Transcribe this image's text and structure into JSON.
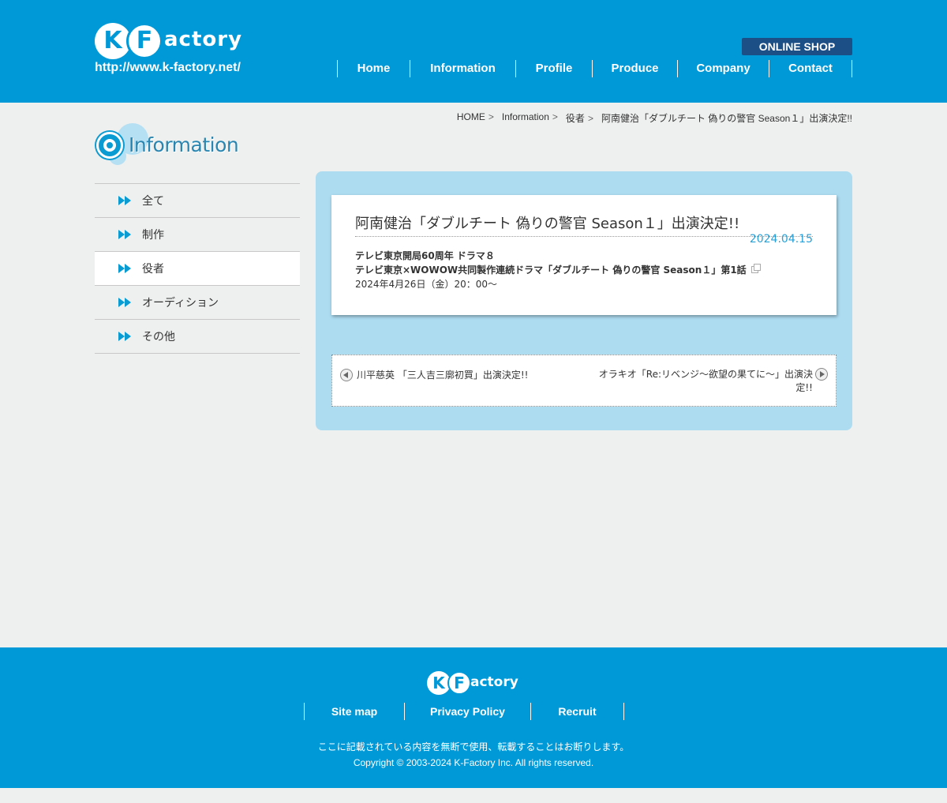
{
  "header": {
    "logo_k": "K",
    "logo_f": "F",
    "logo_rest": "actory",
    "url": "http://www.k-factory.net/",
    "shop_label": "ONLINE SHOP",
    "nav": [
      {
        "label": "Home"
      },
      {
        "label": "Information"
      },
      {
        "label": "Profile"
      },
      {
        "label": "Produce"
      },
      {
        "label": "Company"
      },
      {
        "label": "Contact"
      }
    ]
  },
  "breadcrumb": {
    "items": [
      "HOME",
      "Information",
      "役者"
    ],
    "current": "阿南健治「ダブルチート 偽りの警官 Season１」出演決定!!"
  },
  "section": {
    "title": "Information"
  },
  "sidebar": {
    "items": [
      {
        "label": "全て"
      },
      {
        "label": "制作"
      },
      {
        "label": "役者"
      },
      {
        "label": "オーディション"
      },
      {
        "label": "その他"
      }
    ]
  },
  "article": {
    "title": "阿南健治「ダブルチート 偽りの警官 Season１」出演決定!!",
    "date": "2024.04.15",
    "line1": "テレビ東京開局60周年 ドラマ８",
    "line2": "テレビ東京×WOWOW共同製作連続ドラマ「ダブルチート 偽りの警官 Season１」第1話",
    "line3": "2024年4月26日（金）20：00〜"
  },
  "pager": {
    "prev": "川平慈英 「三人吉三廓初買」出演決定!!",
    "next": "オラキオ「Re:リベンジ〜欲望の果てに〜」出演決定!!"
  },
  "footer": {
    "logo_k": "K",
    "logo_f": "F",
    "logo_rest": "actory",
    "nav": [
      {
        "label": "Site map"
      },
      {
        "label": "Privacy Policy"
      },
      {
        "label": "Recruit"
      }
    ],
    "note": "ここに記載されている内容を無断で使用、転載することはお断りします。",
    "copyright": "Copyright © 2003-2024 K-Factory Inc. All rights reserved."
  },
  "colors": {
    "brand_blue": "#0099d8",
    "shop_button": "#1b4f86",
    "panel_bg": "#addcf1",
    "date_color": "#2aa0d6",
    "page_bg": "#eef0ef"
  }
}
